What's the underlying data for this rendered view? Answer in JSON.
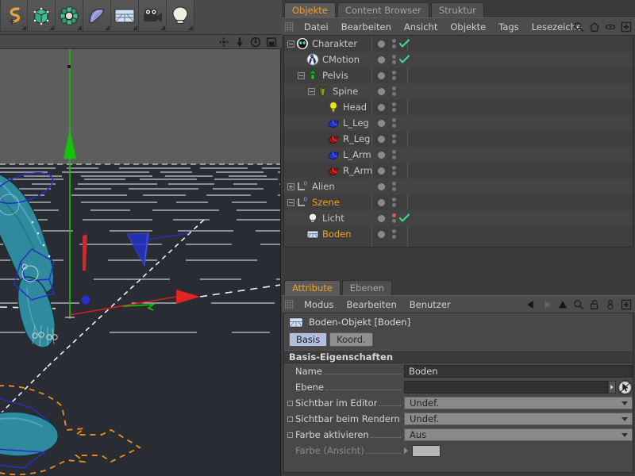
{
  "toolbar": {
    "buttons": [
      {
        "name": "spline-tool",
        "icon": "spline-icon",
        "label": "Spline"
      },
      {
        "name": "cube-primitive",
        "icon": "cube-icon",
        "label": "Würfel"
      },
      {
        "name": "nurbs-generator",
        "icon": "nurbs-icon",
        "label": "NURBS"
      },
      {
        "name": "deformer",
        "icon": "bend-deformer-icon",
        "label": "Deformer"
      },
      {
        "name": "scene-floor",
        "icon": "floor-icon",
        "label": "Boden"
      },
      {
        "name": "camera",
        "icon": "camera-icon",
        "label": "Kamera"
      },
      {
        "name": "light",
        "icon": "light-bulb-icon",
        "label": "Licht"
      }
    ]
  },
  "viewport_nav": {
    "buttons": [
      {
        "name": "pan-view",
        "icon": "move-icon"
      },
      {
        "name": "dolly-view",
        "icon": "dolly-icon"
      },
      {
        "name": "rotate-view",
        "icon": "rotate-icon"
      },
      {
        "name": "maximize-view",
        "icon": "maximize-icon"
      }
    ]
  },
  "object_manager": {
    "tabs": [
      {
        "label": "Objekte",
        "active": true
      },
      {
        "label": "Content Browser",
        "active": false
      },
      {
        "label": "Struktur",
        "active": false
      }
    ],
    "menu": [
      "Datei",
      "Bearbeiten",
      "Ansicht",
      "Objekte",
      "Tags",
      "Lesezeiche"
    ],
    "menu_icons": [
      "search-icon",
      "home-icon",
      "eye-icon",
      "plus-box-icon"
    ],
    "rows": [
      {
        "label": "Charakter",
        "depth": 0,
        "icon": "character-icon",
        "expander": "minus",
        "selected": false,
        "check": true,
        "dot2": "gray"
      },
      {
        "label": "CMotion",
        "depth": 1,
        "icon": "cmotion-icon",
        "expander": "none",
        "selected": false,
        "check": true,
        "dot2": "gray"
      },
      {
        "label": "Pelvis",
        "depth": 1,
        "icon": "joint-green-icon",
        "expander": "minus",
        "selected": false,
        "check": false,
        "dot2": "gray"
      },
      {
        "label": "Spine",
        "depth": 2,
        "icon": "joint-olive-icon",
        "expander": "minus",
        "selected": false,
        "check": false,
        "dot2": "gray"
      },
      {
        "label": "Head",
        "depth": 3,
        "icon": "joint-yellow-icon",
        "expander": "none",
        "selected": false,
        "check": false,
        "dot2": "gray"
      },
      {
        "label": "L_Leg",
        "depth": 3,
        "icon": "joint-blue-icon",
        "expander": "none",
        "selected": false,
        "check": false,
        "dot2": "gray"
      },
      {
        "label": "R_Leg",
        "depth": 3,
        "icon": "joint-red-icon",
        "expander": "none",
        "selected": false,
        "check": false,
        "dot2": "gray"
      },
      {
        "label": "L_Arm",
        "depth": 3,
        "icon": "joint-blue-icon",
        "expander": "none",
        "selected": false,
        "check": false,
        "dot2": "gray"
      },
      {
        "label": "R_Arm",
        "depth": 3,
        "icon": "joint-red-icon",
        "expander": "none",
        "selected": false,
        "check": false,
        "dot2": "gray"
      },
      {
        "label": "Alien",
        "depth": 0,
        "icon": "null-object-icon",
        "expander": "plus",
        "selected": false,
        "check": false,
        "dot2": "gray"
      },
      {
        "label": "Szene",
        "depth": 0,
        "icon": "null-object-icon",
        "expander": "minus",
        "selected": true,
        "check": false,
        "dot2": "gray"
      },
      {
        "label": "Licht",
        "depth": 1,
        "icon": "light-object-icon",
        "expander": "none",
        "selected": false,
        "check": true,
        "dot2": "red"
      },
      {
        "label": "Boden",
        "depth": 1,
        "icon": "floor-object-icon",
        "expander": "none",
        "selected": true,
        "check": false,
        "dot2": "gray"
      }
    ]
  },
  "attribute_manager": {
    "tabs": [
      {
        "label": "Attribute",
        "active": true
      },
      {
        "label": "Ebenen",
        "active": false
      }
    ],
    "menu": [
      "Modus",
      "Bearbeiten",
      "Benutzer"
    ],
    "menu_icons": [
      "back-arrow-icon",
      "forward-arrow-icon",
      "up-arrow-icon",
      "search-icon",
      "lock-icon",
      "pin-icon",
      "plus-box-icon"
    ],
    "object_title": "Boden-Objekt [Boden]",
    "object_icon": "floor-object-icon",
    "subtabs": [
      {
        "label": "Basis",
        "active": true
      },
      {
        "label": "Koord.",
        "active": false
      }
    ],
    "section_title": "Basis-Eigenschaften",
    "properties": [
      {
        "label": "Name",
        "type": "text",
        "value": "Boden",
        "checkbox": false,
        "dim": false
      },
      {
        "label": "Ebene",
        "type": "layer",
        "value": "",
        "checkbox": false,
        "dim": false
      },
      {
        "label": "Sichtbar im Editor",
        "type": "dropdown",
        "value": "Undef.",
        "checkbox": true,
        "dim": false
      },
      {
        "label": "Sichtbar beim Rendern",
        "type": "dropdown",
        "value": "Undef.",
        "checkbox": true,
        "dim": false
      },
      {
        "label": "Farbe aktivieren",
        "type": "dropdown",
        "value": "Aus",
        "checkbox": true,
        "dim": false
      },
      {
        "label": "Farbe (Ansicht)",
        "type": "color",
        "value": "",
        "checkbox": false,
        "dim": true
      }
    ]
  },
  "viewport": {
    "background_color": "#292d33",
    "axis_y_color": "#16c20a",
    "axis_x_color": "#cf2020",
    "axis_z_color": "#2430c8",
    "mesh_color": "#2f8a9e",
    "selection_color": "#e08a20",
    "grid_color": "#ffffff"
  },
  "colors": {
    "accent": "#f2a01e",
    "panel_bg": "#3a3a3a",
    "tab_active": "#5a5a5a"
  }
}
